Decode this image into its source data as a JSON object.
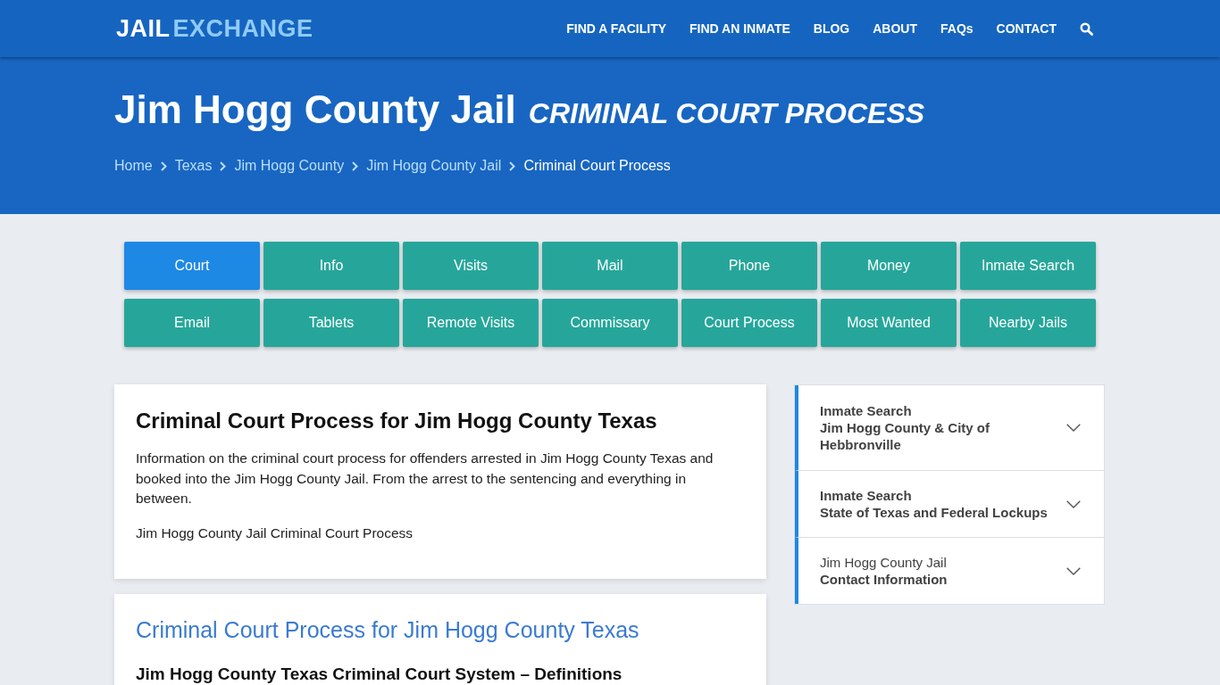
{
  "header": {
    "logo": {
      "first_part": "JAIL",
      "second_part": "EXCHANGE"
    },
    "nav": [
      {
        "label": "FIND A FACILITY"
      },
      {
        "label": "FIND AN INMATE"
      },
      {
        "label": "BLOG"
      },
      {
        "label": "ABOUT"
      },
      {
        "label": "FAQs"
      },
      {
        "label": "CONTACT"
      }
    ]
  },
  "hero": {
    "title": "Jim Hogg County Jail",
    "subtitle": "CRIMINAL COURT PROCESS",
    "breadcrumbs": [
      {
        "label": "Home",
        "current": false
      },
      {
        "label": "Texas",
        "current": false
      },
      {
        "label": "Jim Hogg County",
        "current": false
      },
      {
        "label": "Jim Hogg County Jail",
        "current": false
      },
      {
        "label": "Criminal Court Process",
        "current": true
      }
    ]
  },
  "tabs": [
    {
      "label": "Court",
      "selected": true
    },
    {
      "label": "Info",
      "selected": false
    },
    {
      "label": "Visits",
      "selected": false
    },
    {
      "label": "Mail",
      "selected": false
    },
    {
      "label": "Phone",
      "selected": false
    },
    {
      "label": "Money",
      "selected": false
    },
    {
      "label": "Inmate Search",
      "selected": false
    },
    {
      "label": "Email",
      "selected": false
    },
    {
      "label": "Tablets",
      "selected": false
    },
    {
      "label": "Remote Visits",
      "selected": false
    },
    {
      "label": "Commissary",
      "selected": false
    },
    {
      "label": "Court Process",
      "selected": false
    },
    {
      "label": "Most Wanted",
      "selected": false
    },
    {
      "label": "Nearby Jails",
      "selected": false
    }
  ],
  "main": {
    "intro_card": {
      "title": "Criminal Court Process for Jim Hogg County Texas",
      "paragraphs": [
        "Information on the criminal court process for offenders arrested in Jim Hogg County Texas and booked into the Jim Hogg County Jail. From the arrest to the sentencing and everything in between.",
        "Jim Hogg County Jail Criminal Court Process"
      ]
    },
    "section_card": {
      "title": "Criminal Court Process for Jim Hogg County Texas",
      "subtitle": "Jim Hogg County Texas Criminal Court System – Definitions"
    }
  },
  "sidebar": {
    "items": [
      {
        "lines": [
          {
            "text": "Inmate Search",
            "bold": true
          },
          {
            "text": "Jim Hogg County & City of Hebbronville",
            "bold": true
          }
        ],
        "expanded": false
      },
      {
        "lines": [
          {
            "text": "Inmate Search",
            "bold": true
          },
          {
            "text": "State of Texas and Federal Lockups",
            "bold": true
          }
        ],
        "expanded": false
      },
      {
        "lines": [
          {
            "text": "Jim Hogg County Jail",
            "bold": false
          },
          {
            "text": "Contact Information",
            "bold": true
          }
        ],
        "expanded": false
      }
    ]
  }
}
